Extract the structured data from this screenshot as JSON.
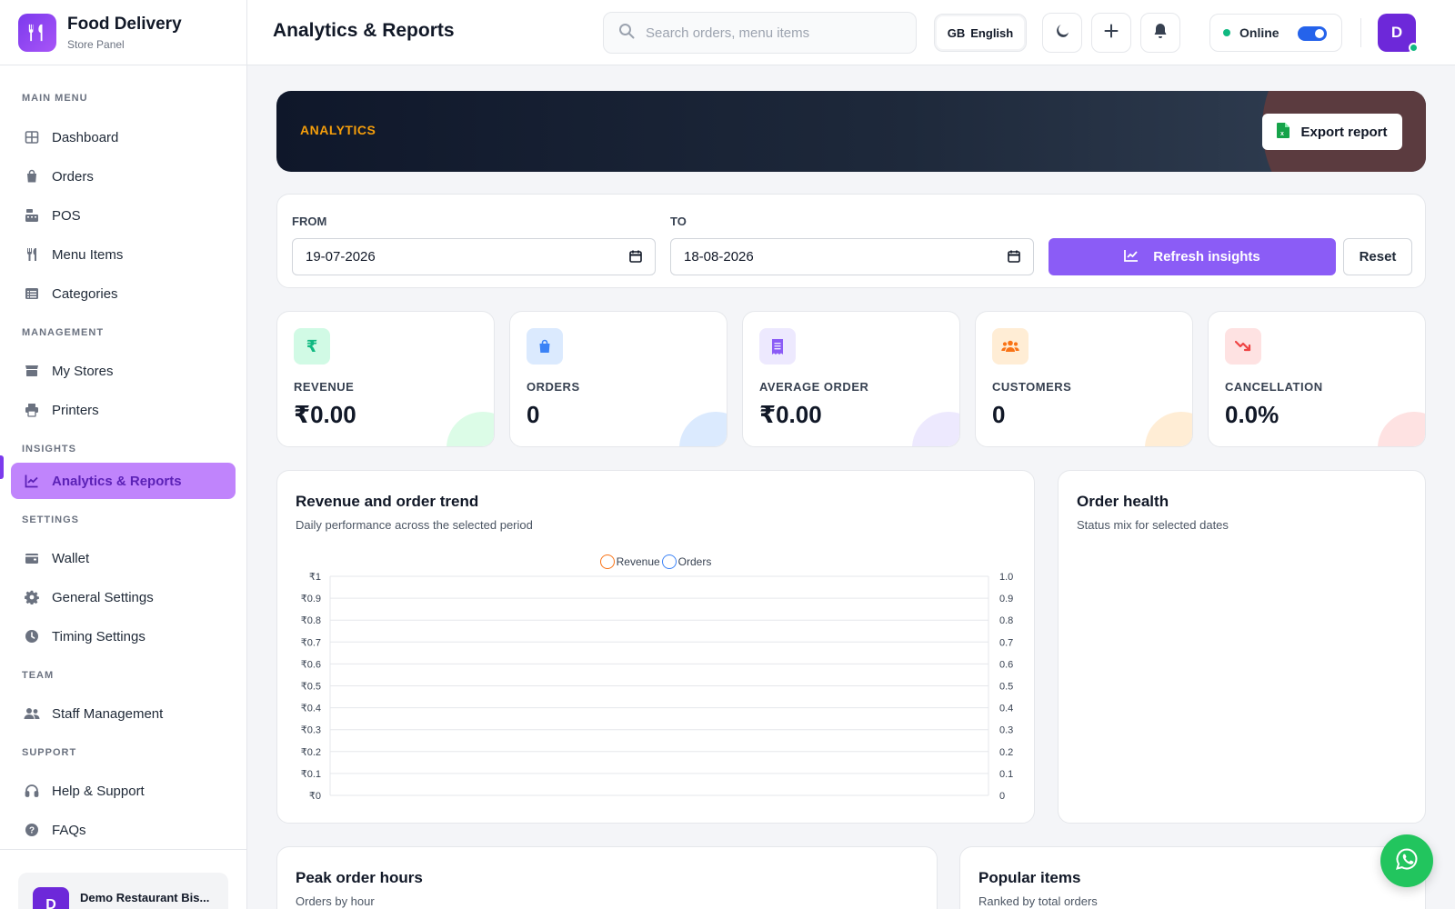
{
  "brand": {
    "title": "Food Delivery",
    "subtitle": "Store Panel",
    "logo_icon": "fork-knife-icon"
  },
  "sidebar": {
    "sections": [
      {
        "label": "MAIN MENU",
        "items": [
          {
            "label": "Dashboard",
            "icon": "grid-icon"
          },
          {
            "label": "Orders",
            "icon": "shopping-bag-icon"
          },
          {
            "label": "POS",
            "icon": "cash-register-icon"
          },
          {
            "label": "Menu Items",
            "icon": "utensils-icon"
          },
          {
            "label": "Categories",
            "icon": "list-icon"
          }
        ]
      },
      {
        "label": "MANAGEMENT",
        "items": [
          {
            "label": "My Stores",
            "icon": "store-icon"
          },
          {
            "label": "Printers",
            "icon": "printer-icon"
          }
        ]
      },
      {
        "label": "INSIGHTS",
        "items": [
          {
            "label": "Analytics & Reports",
            "icon": "chart-line-icon",
            "active": true
          }
        ]
      },
      {
        "label": "SETTINGS",
        "items": [
          {
            "label": "Wallet",
            "icon": "wallet-icon"
          },
          {
            "label": "General Settings",
            "icon": "gear-icon"
          },
          {
            "label": "Timing Settings",
            "icon": "clock-icon"
          }
        ]
      },
      {
        "label": "TEAM",
        "items": [
          {
            "label": "Staff Management",
            "icon": "users-icon"
          }
        ]
      },
      {
        "label": "SUPPORT",
        "items": [
          {
            "label": "Help & Support",
            "icon": "headset-icon"
          },
          {
            "label": "FAQs",
            "icon": "question-icon"
          }
        ]
      }
    ],
    "store": {
      "avatar": "D",
      "name": "Demo Restaurant Bis..."
    }
  },
  "header": {
    "title": "Analytics & Reports",
    "search_placeholder": "Search orders, menu items",
    "language_flag": "GB",
    "language": "English",
    "status": "Online",
    "user_initial": "D"
  },
  "banner": {
    "label": "ANALYTICS",
    "export_label": "Export report"
  },
  "filter": {
    "from_label": "FROM",
    "from_value": "19-07-2026",
    "to_label": "TO",
    "to_value": "18-08-2026",
    "refresh_label": "Refresh insights",
    "reset_label": "Reset"
  },
  "stats": [
    {
      "label": "REVENUE",
      "value": "₹0.00",
      "icon": "rupee-icon",
      "icon_glyph": "₹",
      "color": "#10b981",
      "bg": "#d1fae5",
      "deco": "#dcfce7"
    },
    {
      "label": "ORDERS",
      "value": "0",
      "icon": "shopping-bag-icon",
      "color": "#3b82f6",
      "bg": "#dbeafe",
      "deco": "#dbeafe"
    },
    {
      "label": "AVERAGE ORDER",
      "value": "₹0.00",
      "icon": "receipt-icon",
      "color": "#8b5cf6",
      "bg": "#ede9fe",
      "deco": "#ede9fe"
    },
    {
      "label": "CUSTOMERS",
      "value": "0",
      "icon": "users-icon",
      "color": "#f97316",
      "bg": "#ffedd5",
      "deco": "#ffedd5"
    },
    {
      "label": "CANCELLATION",
      "value": "0.0%",
      "icon": "trend-down-icon",
      "color": "#ef4444",
      "bg": "#fee2e2",
      "deco": "#fee2e2"
    }
  ],
  "trend_card": {
    "title": "Revenue and order trend",
    "subtitle": "Daily performance across the selected period"
  },
  "health_card": {
    "title": "Order health",
    "subtitle": "Status mix for selected dates"
  },
  "peak_card": {
    "title": "Peak order hours",
    "subtitle": "Orders by hour"
  },
  "popular_card": {
    "title": "Popular items",
    "subtitle": "Ranked by total orders"
  },
  "chart_data": {
    "type": "line",
    "categories": [],
    "series": [
      {
        "name": "Revenue",
        "values": [],
        "color": "#f97316",
        "axis": "left"
      },
      {
        "name": "Orders",
        "values": [],
        "color": "#3b82f6",
        "axis": "right"
      }
    ],
    "left_axis": {
      "ylim": [
        0,
        1
      ],
      "ticks": [
        "₹0",
        "₹0.1",
        "₹0.2",
        "₹0.3",
        "₹0.4",
        "₹0.5",
        "₹0.6",
        "₹0.7",
        "₹0.8",
        "₹0.9",
        "₹1"
      ]
    },
    "right_axis": {
      "ylim": [
        0,
        1
      ],
      "ticks": [
        "0",
        "0.1",
        "0.2",
        "0.3",
        "0.4",
        "0.5",
        "0.6",
        "0.7",
        "0.8",
        "0.9",
        "1.0"
      ]
    },
    "grid": true,
    "legend": "top-center"
  },
  "colors": {
    "accent": "#8b5cf6",
    "active_nav_bg": "#c084fc",
    "online": "#10b981",
    "whatsapp": "#22c55e"
  }
}
